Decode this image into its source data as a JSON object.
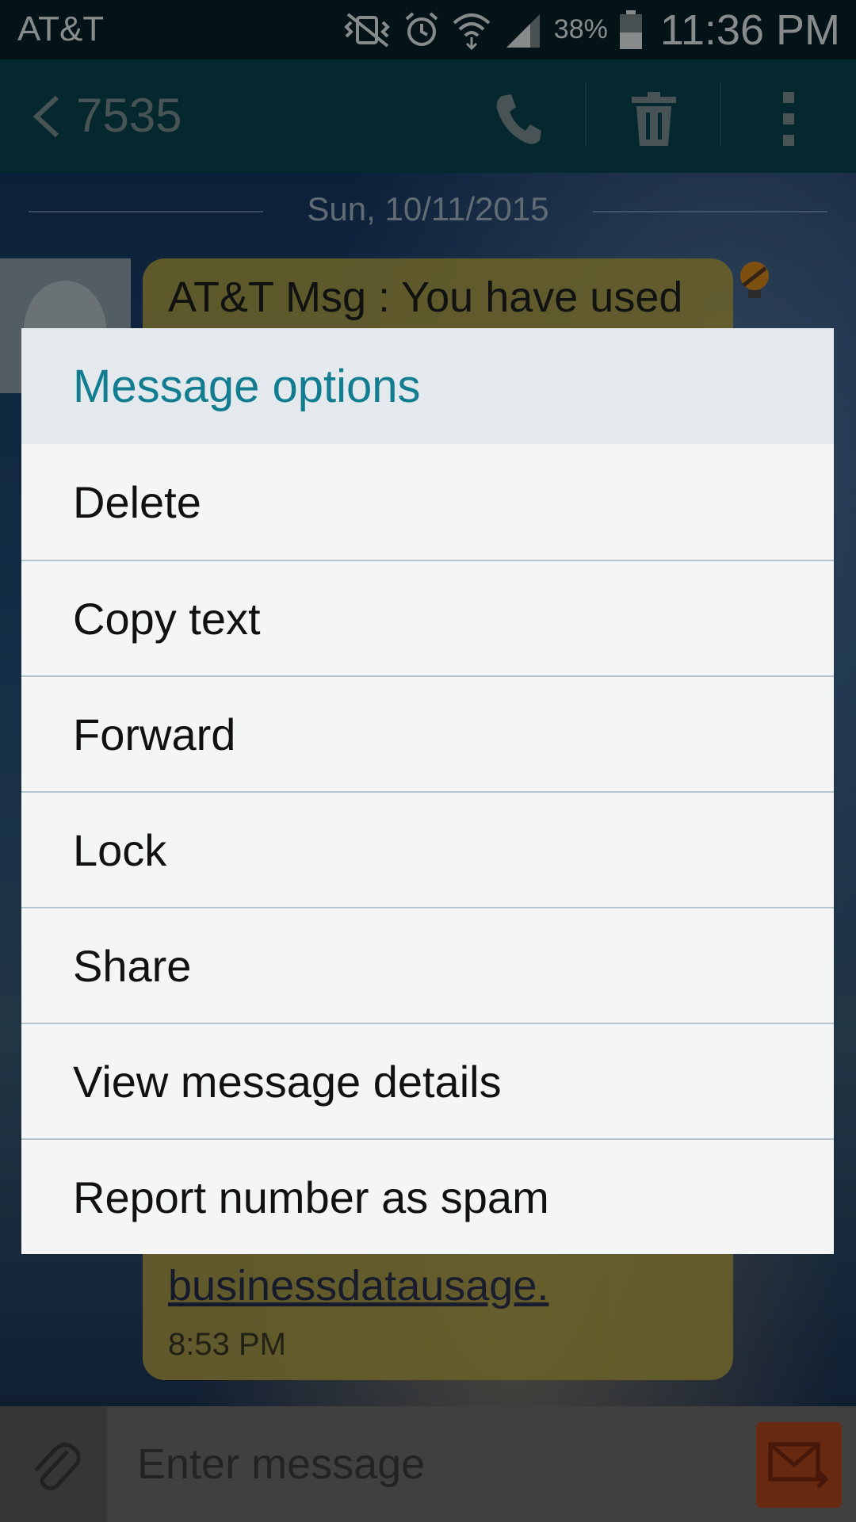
{
  "status_bar": {
    "carrier": "AT&T",
    "battery": "38%",
    "time": "11:36 PM",
    "icons": [
      "vibrate-off-icon",
      "alarm-icon",
      "wifi-icon",
      "signal-icon",
      "battery-icon"
    ]
  },
  "header": {
    "contact": "7535",
    "buttons": [
      "back-icon",
      "call-icon",
      "delete-icon",
      "overflow-menu-icon"
    ]
  },
  "conversation": {
    "date": "Sun, 10/11/2015",
    "message_first_line": "AT&T Msg : You have used",
    "message_link": "businessdatausage.",
    "message_time": "8:53 PM"
  },
  "dialog": {
    "title": "Message options",
    "items": [
      {
        "label": "Delete"
      },
      {
        "label": "Copy text"
      },
      {
        "label": "Forward"
      },
      {
        "label": "Lock"
      },
      {
        "label": "Share"
      },
      {
        "label": "View message details"
      },
      {
        "label": "Report number as spam"
      }
    ]
  },
  "input": {
    "placeholder": "Enter message"
  },
  "colors": {
    "status_bar": "#06222a",
    "action_bar": "#094650",
    "dialog_title_text": "#127c91",
    "bubble": "#b6a648",
    "send_button": "#b2481c"
  }
}
